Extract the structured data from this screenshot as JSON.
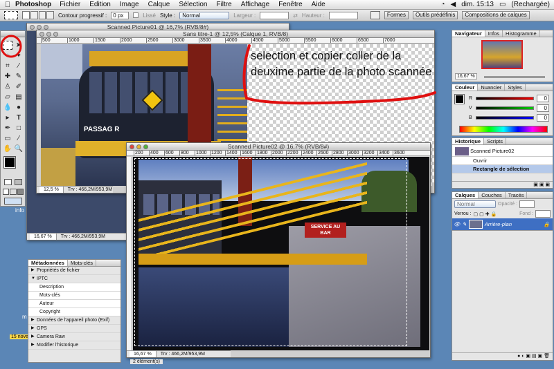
{
  "menubar": {
    "app_name": "Photoshop",
    "items": [
      "Fichier",
      "Edition",
      "Image",
      "Calque",
      "Sélection",
      "Filtre",
      "Affichage",
      "Fenêtre",
      "Aide"
    ],
    "clock": "dim. 15:13",
    "battery": "(Rechargée)"
  },
  "options_bar": {
    "feather_label": "Contour progressif :",
    "feather_value": "0 px",
    "antialias_label": "Lissé",
    "style_label": "Style :",
    "style_value": "Normal",
    "width_label": "Largeur :",
    "height_label": "Hauteur :",
    "well_tabs": [
      "Formes",
      "Outils prédéfinis",
      "Compositions de calques"
    ]
  },
  "windows": {
    "scanned01_title": "Scanned Picture01 @ 16,7% (RVB/8#)",
    "sans_titre_title": "Sans titre-1 @ 12,5% (Calque 1, RVB/8)",
    "sans_titre_zoom": "12,5 %",
    "sans_titre_status": "Trv : 466,2M/953,9M",
    "scanned01_zoom": "16,67 %",
    "scanned01_status": "Trv : 466,2M/953,9M",
    "scanned02_title": "Scanned Picture02 @ 16,7% (RVB/8#)",
    "scanned02_zoom": "16,67 %",
    "scanned02_status": "Trv : 466,2M/953,9M",
    "ruler_ticks_top": [
      "500",
      "1000",
      "1500",
      "2000",
      "2500",
      "3000",
      "3500",
      "4000",
      "4500",
      "5000",
      "5500",
      "6000",
      "6500",
      "7000"
    ],
    "ruler_ticks_02": [
      "200",
      "400",
      "600",
      "800",
      "1000",
      "1200",
      "1400",
      "1600",
      "1800",
      "2000",
      "2200",
      "2400",
      "2600",
      "2800",
      "3000",
      "3200",
      "3400",
      "3600"
    ]
  },
  "photo": {
    "boat_name": "PASSAG R",
    "sign_text": "SERVICE AU BAR"
  },
  "annotation": {
    "text": "selection et copier coller de la deuxime partie de la photo scannée",
    "color": "#e01010"
  },
  "navigator": {
    "tabs": [
      "Navigateur",
      "Infos",
      "Histogramme"
    ],
    "zoom": "16,67 %"
  },
  "color_panel": {
    "tabs": [
      "Couleur",
      "Nuancier",
      "Styles"
    ],
    "channels": [
      {
        "label": "R",
        "value": "0"
      },
      {
        "label": "V",
        "value": "0"
      },
      {
        "label": "B",
        "value": "0"
      }
    ]
  },
  "history": {
    "tabs": [
      "Historique",
      "Scripts"
    ],
    "snapshot": "Scanned Picture02",
    "items": [
      "Ouvrir",
      "Rectangle de sélection"
    ]
  },
  "layers": {
    "tabs": [
      "Calques",
      "Couches",
      "Tracés"
    ],
    "mode": "Normal",
    "opacity_label": "Opacité :",
    "lock_label": "Verrou :",
    "fill_label": "Fond :",
    "layer_name": "Arrière-plan"
  },
  "metadata": {
    "tabs": [
      "Métadonnées",
      "Mots-clés"
    ],
    "rows": [
      {
        "label": "Propriétés de fichier",
        "sub": false
      },
      {
        "label": "IPTC",
        "sub": false
      },
      {
        "label": "Description",
        "sub": true
      },
      {
        "label": "Mots-clés",
        "sub": true
      },
      {
        "label": "Auteur",
        "sub": true
      },
      {
        "label": "Copyright",
        "sub": true
      },
      {
        "label": "Données de l'appareil photo (Exif)",
        "sub": false
      },
      {
        "label": "GPS",
        "sub": false
      },
      {
        "label": "Camera Raw",
        "sub": false
      },
      {
        "label": "Modifier l'historique",
        "sub": false
      }
    ],
    "footer": "2 élément(s)"
  },
  "desktop": {
    "label_1": "info",
    "label_2": "m",
    "label_3": "15 nove"
  }
}
